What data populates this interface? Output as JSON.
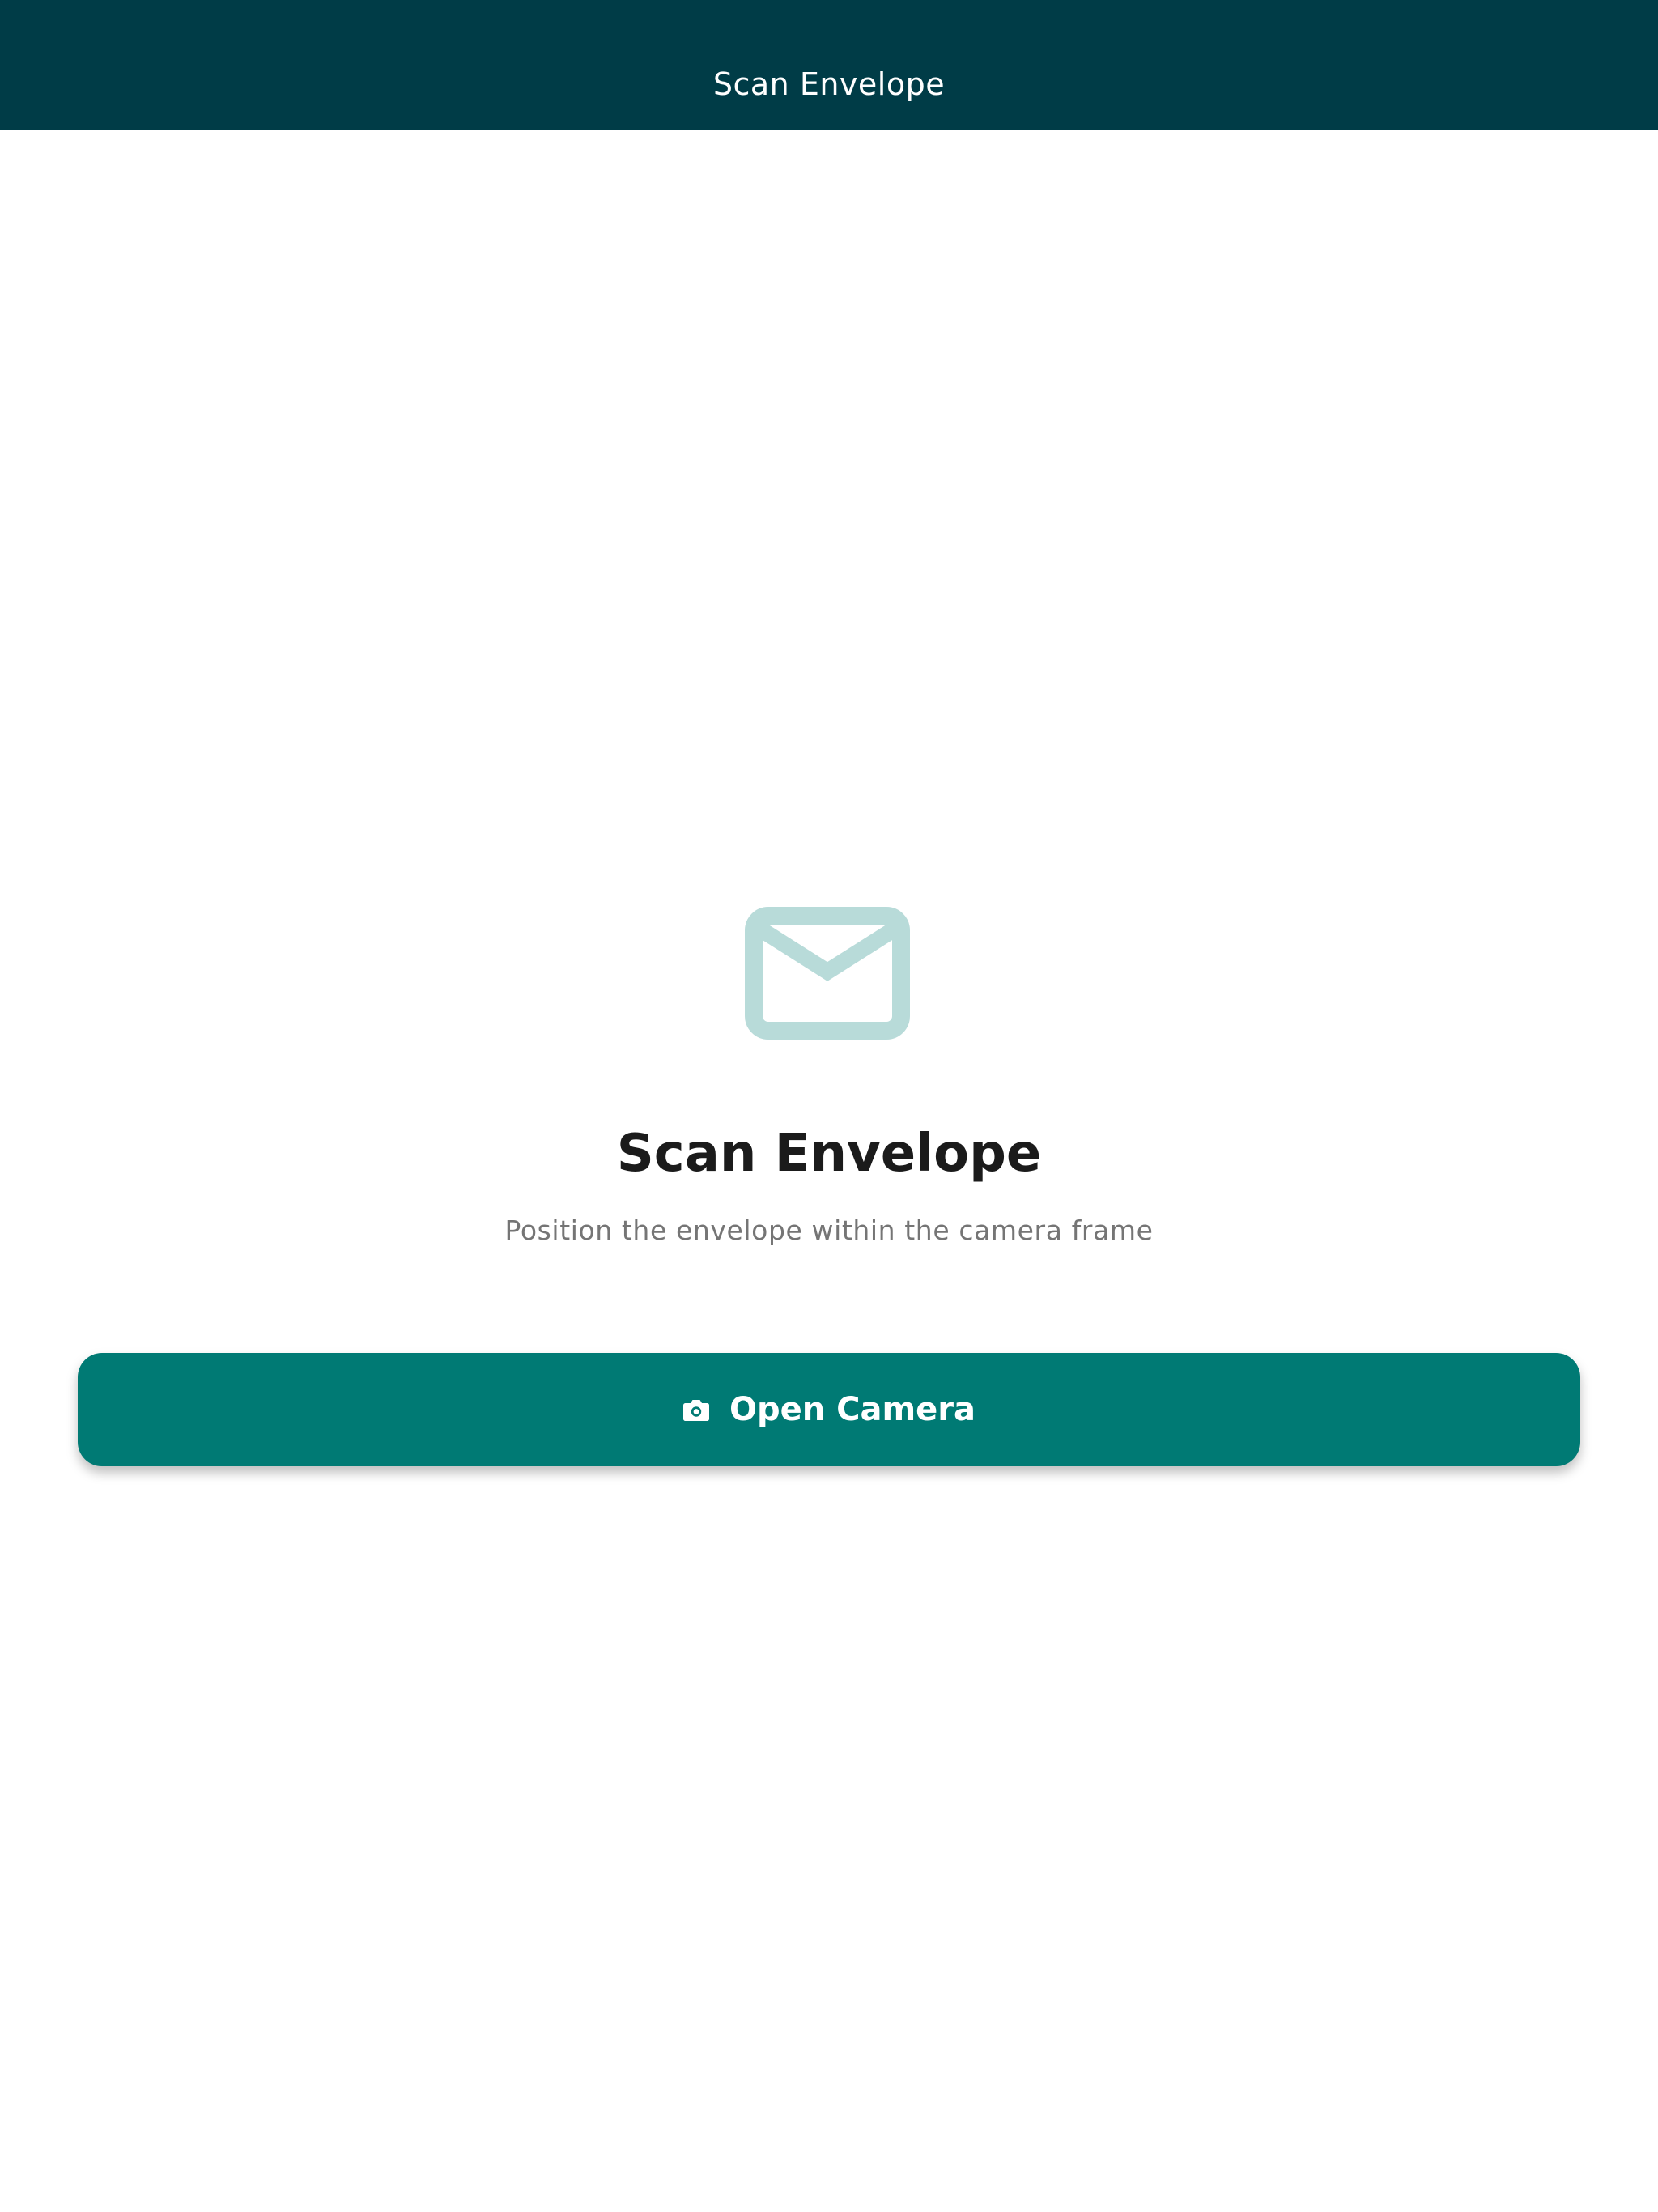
{
  "app_bar": {
    "title": "Scan Envelope"
  },
  "main": {
    "icon": "envelope-icon",
    "heading": "Scan Envelope",
    "subtitle": "Position the envelope within the camera frame"
  },
  "actions": {
    "open_camera": {
      "label": "Open Camera",
      "icon": "camera-icon"
    }
  },
  "colors": {
    "app_bar": "#003c47",
    "primary": "#007a74",
    "icon_tint": "#b8dbd9",
    "heading": "#1b1b1b",
    "subtitle": "#757575",
    "background": "#ffffff"
  }
}
